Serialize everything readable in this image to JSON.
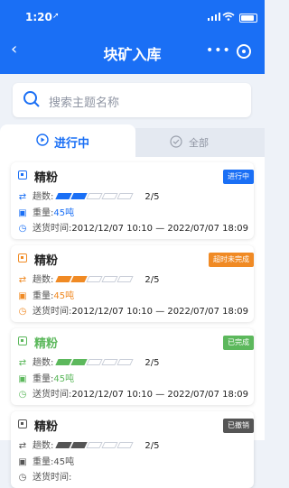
{
  "status": {
    "time": "1:20",
    "arrow": "➚"
  },
  "header": {
    "title": "块矿入库",
    "back": "‹",
    "more": "•••"
  },
  "search": {
    "placeholder": "搜索主题名称"
  },
  "tabs": [
    {
      "label": "进行中",
      "active": true
    },
    {
      "label": "全部",
      "active": false
    }
  ],
  "labels": {
    "count": "趟数:",
    "weight": "重量:",
    "time": "送货时间:"
  },
  "cards": [
    {
      "name": "精粉",
      "badge": "进行中",
      "color": "#1a6ff5",
      "count": "2/5",
      "progress": 0.4,
      "weight": "45吨",
      "time": "2012/12/07 10:10 — 2022/07/07 18:09"
    },
    {
      "name": "精粉",
      "badge": "超时未完成",
      "color": "#f08a24",
      "count": "2/5",
      "progress": 0.4,
      "weight": "45吨",
      "time": "2012/12/07 10:10 — 2022/07/07 18:09"
    },
    {
      "name": "精粉",
      "badge": "已完成",
      "color": "#5cb85c",
      "count": "2/5",
      "progress": 0.4,
      "weight": "45吨",
      "time": "2012/12/07 10:10 — 2022/07/07 18:09"
    },
    {
      "name": "精粉",
      "badge": "已撤销",
      "color": "#555555",
      "count": "2/5",
      "progress": 0.4,
      "weight": "45吨",
      "time": ""
    }
  ]
}
